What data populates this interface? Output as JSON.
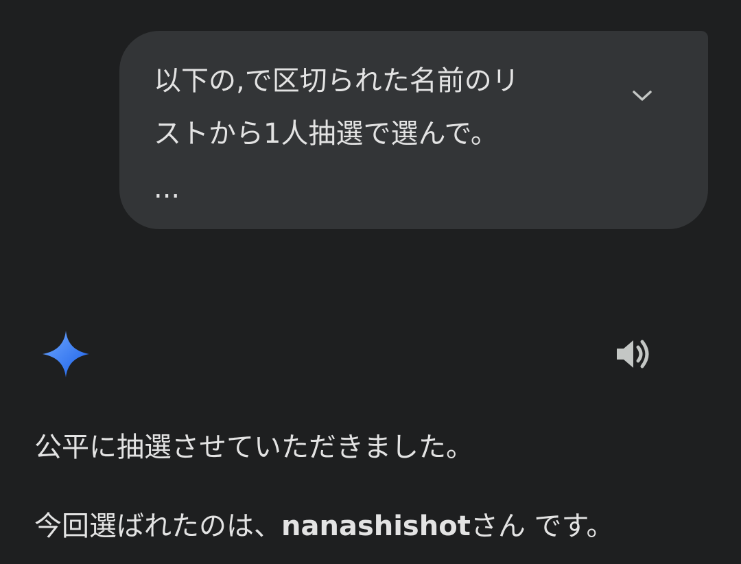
{
  "user_message": {
    "line1": "以下の,で区切られた名前のリ",
    "line2": "ストから1人抽選で選んで。",
    "line3": "..."
  },
  "icons": {
    "expand": "chevron-down-icon",
    "assistant": "sparkle-icon",
    "speaker": "volume-icon"
  },
  "response": {
    "line1": "公平に抽選させていただきました。",
    "line2_prefix": "今回選ばれたのは、",
    "line2_name": "nanashishot",
    "line2_suffix": "さん です。"
  },
  "colors": {
    "background": "#1e1f20",
    "bubble": "#333537",
    "text": "#e3e3e3",
    "sparkle_light": "#6fa8ff",
    "sparkle_dark": "#1a5fe8",
    "icon_gray": "#c4c7c5"
  }
}
